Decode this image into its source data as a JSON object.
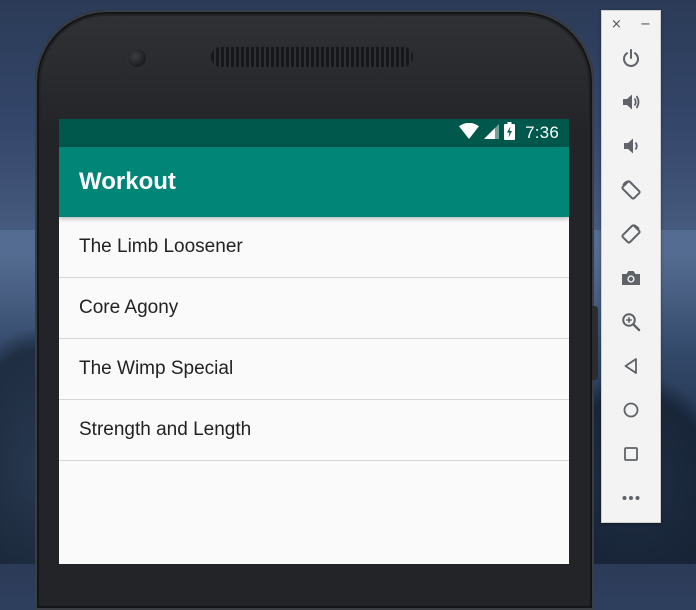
{
  "status_bar": {
    "time": "7:36",
    "icons": [
      "wifi-icon",
      "cell-signal-icon",
      "battery-charging-icon"
    ]
  },
  "app_bar": {
    "title": "Workout"
  },
  "workouts": [
    {
      "name": "The Limb Loosener"
    },
    {
      "name": "Core Agony"
    },
    {
      "name": "The Wimp Special"
    },
    {
      "name": "Strength and Length"
    }
  ],
  "emulator_toolbar": {
    "window_controls": {
      "close": "×",
      "minimize": "−"
    },
    "buttons": [
      "power-icon",
      "volume-up-icon",
      "volume-down-icon",
      "rotate-left-icon",
      "rotate-right-icon",
      "camera-icon",
      "zoom-icon",
      "back-icon",
      "home-icon",
      "overview-icon",
      "more-icon"
    ]
  },
  "colors": {
    "primary": "#008577",
    "primary_dark": "#00574b",
    "list_background": "#fafafa",
    "divider": "#d6d6d6",
    "toolbar_icon": "#5f6368"
  }
}
